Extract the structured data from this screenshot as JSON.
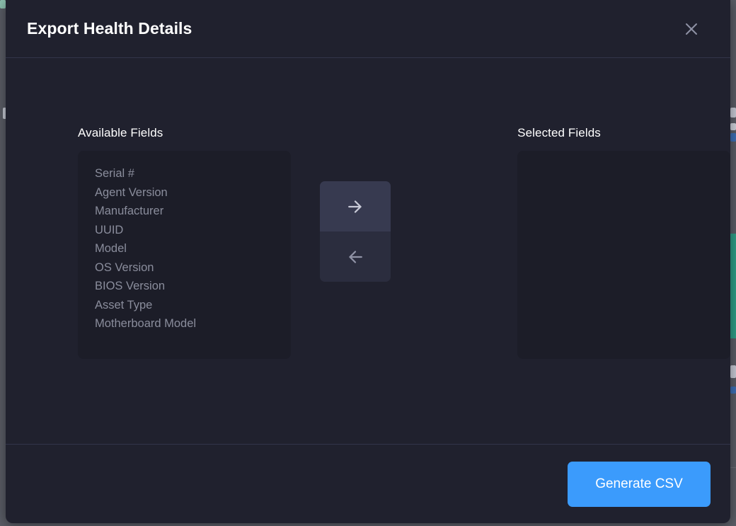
{
  "modal": {
    "title": "Export Health Details",
    "close_icon": "close-icon",
    "available": {
      "heading": "Available Fields",
      "fields": [
        "Serial #",
        "Agent Version",
        "Manufacturer",
        "UUID",
        "Model",
        "OS Version",
        "BIOS Version",
        "Asset Type",
        "Motherboard Model"
      ]
    },
    "selected": {
      "heading": "Selected Fields",
      "fields": []
    },
    "transfer": {
      "move_right_icon": "arrow-right-icon",
      "move_left_icon": "arrow-left-icon"
    },
    "footer": {
      "generate_label": "Generate CSV"
    }
  },
  "colors": {
    "accent": "#3b9bfc",
    "modal_background": "#20212e",
    "panel_background": "#1c1d28",
    "divider": "#33354a",
    "field_text": "#8a8d9c",
    "heading_text": "#ffffff",
    "arrow_button_active": "#373a50",
    "arrow_button_idle": "#2b2d3e"
  }
}
